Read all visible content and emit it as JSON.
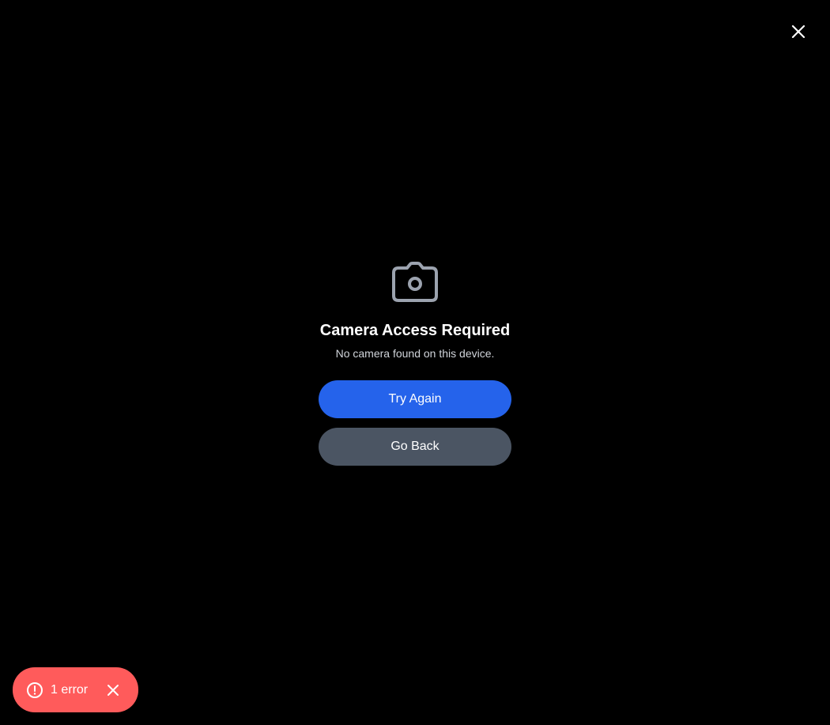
{
  "dialog": {
    "title": "Camera Access Required",
    "message": "No camera found on this device.",
    "primary_button": "Try Again",
    "secondary_button": "Go Back"
  },
  "error_toast": {
    "label": "1 error"
  },
  "icons": {
    "close": "close-icon",
    "camera": "camera-icon",
    "error": "alert-circle-icon",
    "toast_close": "close-icon"
  },
  "colors": {
    "background": "#000000",
    "primary_button": "#2563eb",
    "secondary_button": "#4b5563",
    "error_toast": "#ff5b5b",
    "icon_gray": "#9ca3af"
  }
}
